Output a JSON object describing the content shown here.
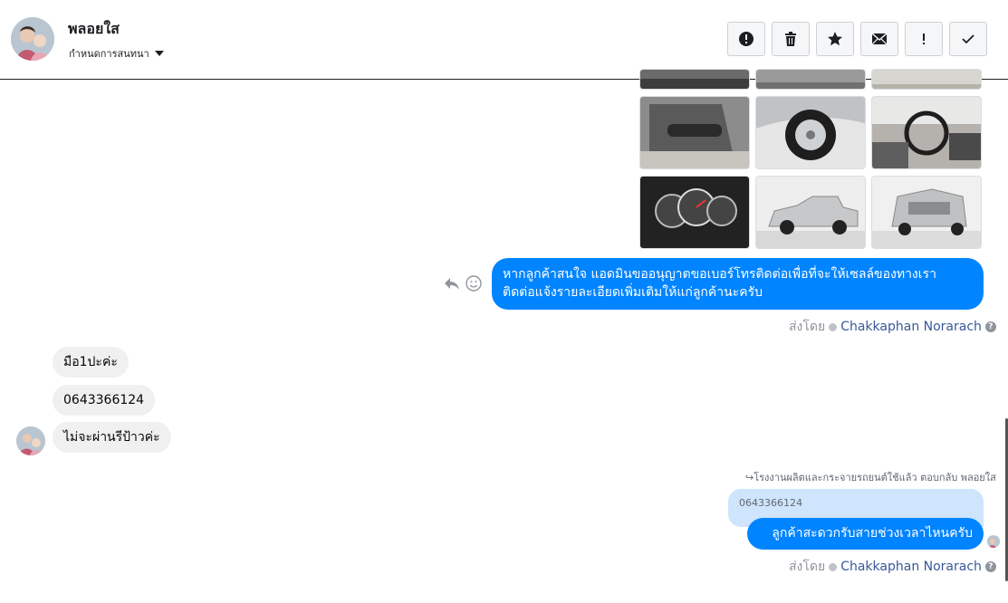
{
  "header": {
    "contact_name": "พลอยใส",
    "conversation_settings": "กำหนดการสนทนา",
    "toolbar": [
      {
        "icon": "alert-circle-icon",
        "name": "spam-button"
      },
      {
        "icon": "trash-icon",
        "name": "delete-button"
      },
      {
        "icon": "star-icon",
        "name": "star-button"
      },
      {
        "icon": "envelope-icon",
        "name": "mark-unread-button"
      },
      {
        "icon": "exclamation-icon",
        "name": "follow-up-button"
      },
      {
        "icon": "checkmark-icon",
        "name": "done-button"
      }
    ]
  },
  "messages": {
    "outgoing_1": {
      "line1": "หากลูกค้าสนใจ แอดมินขออนุญาตขอเบอร์โทรติดต่อเพื่อที่จะให้เซลล์ของทางเรา",
      "line2": "ติดต่อแจ้งรายละเอียดเพิ่มเติมให้แก่ลูกค้านะครับ"
    },
    "sent_by_label": "ส่งโดย",
    "agent_name": "Chakkaphan Norarach",
    "incoming": [
      "มือ1ปะค่ะ",
      "0643366124",
      "ไม่จะผ่านรีป้าวค่ะ"
    ],
    "reply_context": "↪โรงงานผลิตและกระจายรถยนต์ใช้แล้ว ตอบกลับ พลอยใส",
    "quoted_text": "0643366124",
    "outgoing_2": "ลูกค้าสะดวกรับสายช่วงเวลาไหนครับ"
  },
  "colors": {
    "brand_blue": "#0084ff",
    "incoming_gray": "#f1f0f0",
    "quote_blue": "#cfe4fd"
  }
}
